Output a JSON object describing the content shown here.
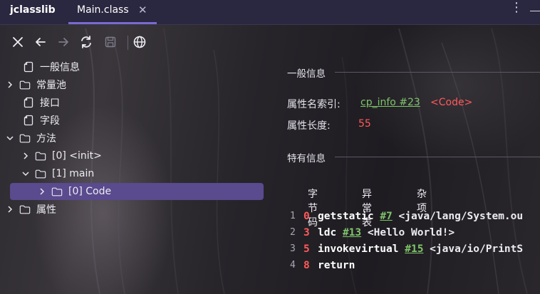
{
  "titlebar": {
    "app_name": "jclasslib",
    "tab_label": "Main.class",
    "tab_close": "✕"
  },
  "toolbar": {
    "buttons": [
      "close-icon",
      "back-arrow-icon",
      "forward-arrow-icon",
      "refresh-icon",
      "save-icon",
      "globe-icon"
    ]
  },
  "tree": {
    "general_info": "一般信息",
    "constant_pool": "常量池",
    "interfaces": "接口",
    "fields": "字段",
    "methods": "方法",
    "method_init": "[0] <init>",
    "method_main": "[1] main",
    "code_attr": "[0] Code",
    "attributes": "属性"
  },
  "detail": {
    "general_title": "一般信息",
    "attr_name_index_label": "属性名索引:",
    "attr_name_index_link": "cp_info #23",
    "attr_name_index_value": "<Code>",
    "attr_length_label": "属性长度:",
    "attr_length_value": "55",
    "specific_title": "特有信息",
    "tabs": [
      "字节码",
      "异常表",
      "杂项"
    ]
  },
  "bytecode": [
    {
      "line": "1",
      "offset": "0",
      "op": "getstatic",
      "ref": "#7",
      "comment": "<java/lang/System.ou"
    },
    {
      "line": "2",
      "offset": "3",
      "op": "ldc",
      "ref": "#13",
      "comment": "<Hello World!>"
    },
    {
      "line": "3",
      "offset": "5",
      "op": "invokevirtual",
      "ref": "#15",
      "comment": "<java/io/PrintS"
    },
    {
      "line": "4",
      "offset": "8",
      "op": "return",
      "ref": "",
      "comment": ""
    }
  ]
}
